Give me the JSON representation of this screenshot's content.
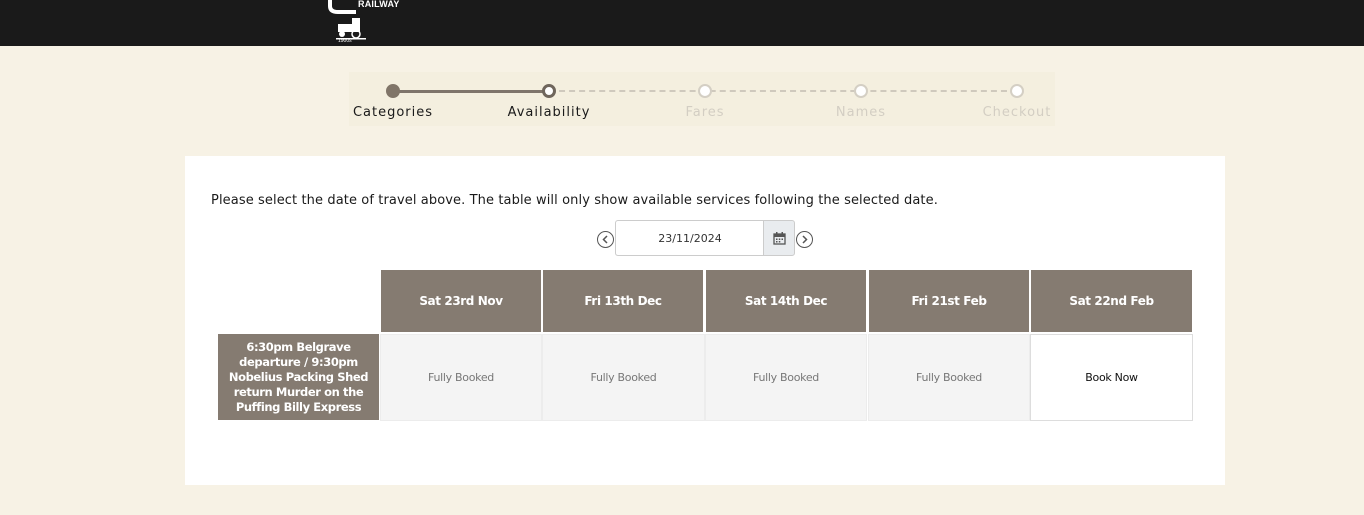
{
  "header": {
    "logo_text": "RAILWAY"
  },
  "stepper": {
    "steps": [
      {
        "label": "Categories",
        "state": "done"
      },
      {
        "label": "Availability",
        "state": "current"
      },
      {
        "label": "Fares",
        "state": "todo"
      },
      {
        "label": "Names",
        "state": "todo"
      },
      {
        "label": "Checkout",
        "state": "todo"
      }
    ]
  },
  "main": {
    "instruction": "Please select the date of travel above. The table will only show available services following the selected date.",
    "date_value": "23/11/2024",
    "table": {
      "columns": [
        "Sat 23rd Nov",
        "Fri 13th Dec",
        "Sat 14th Dec",
        "Fri 21st Feb",
        "Sat 22nd Feb"
      ],
      "rows": [
        {
          "service": "6:30pm Belgrave departure / 9:30pm Nobelius Packing Shed return Murder on the Puffing Billy Express",
          "cells": [
            "Fully Booked",
            "Fully Booked",
            "Fully Booked",
            "Fully Booked",
            "Book Now"
          ]
        }
      ]
    }
  },
  "colors": {
    "header_bg": "#1a1a1a",
    "page_bg": "#f7f2e5",
    "table_header": "#857b71",
    "step_done": "#807568",
    "step_todo": "#d4cfc4"
  },
  "icons": {
    "prev": "chevron-left-circle-icon",
    "next": "chevron-right-circle-icon",
    "calendar": "calendar-icon"
  }
}
